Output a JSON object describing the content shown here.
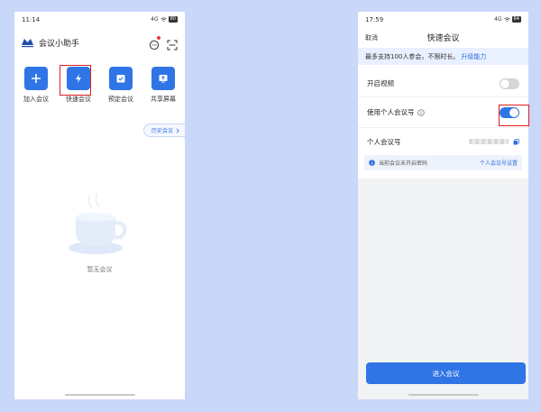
{
  "left": {
    "status_time": "11:14",
    "status_signal": "4G",
    "status_battery": "80",
    "app_title": "会议小助手",
    "actions": [
      {
        "label": "加入会议"
      },
      {
        "label": "快速会议"
      },
      {
        "label": "预定会议"
      },
      {
        "label": "共享屏幕"
      }
    ],
    "history_label": "历史会议",
    "empty_text": "暂无会议"
  },
  "right": {
    "status_time": "17:59",
    "status_signal": "4G",
    "status_battery": "64",
    "cancel_label": "取消",
    "nav_title": "快速会议",
    "banner_text": "最多支持100人参会，不限时长。",
    "banner_link": "升级能力",
    "video_label": "开启视频",
    "video_on": false,
    "personal_id_label": "使用个人会议号",
    "personal_id_on": true,
    "personal_number_label": "个人会议号",
    "notice_text": "当前会议未开启密码",
    "notice_link": "个人会议号设置",
    "enter_label": "进入会议"
  },
  "colors": {
    "background": "#c9d7f8",
    "accent": "#2f75e6",
    "highlight": "#e02020",
    "link": "#2f6fe0"
  }
}
